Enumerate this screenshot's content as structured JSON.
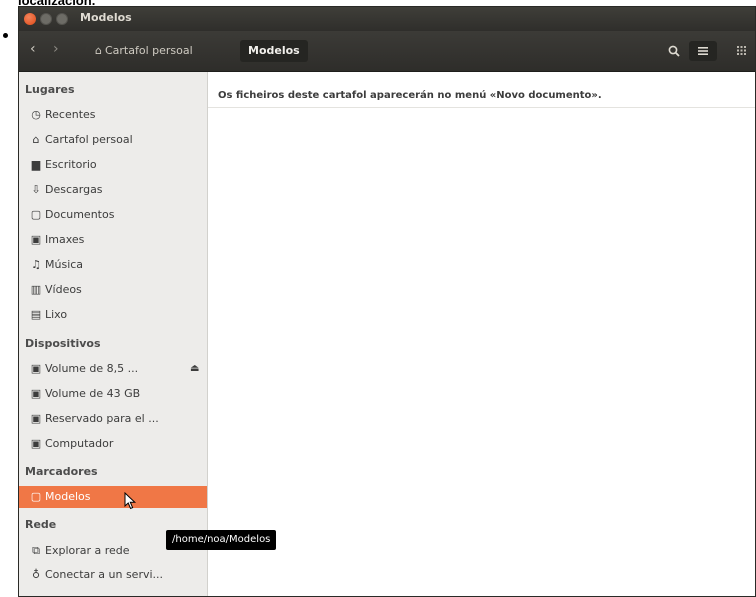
{
  "caption": "localización.",
  "window": {
    "title": "Modelos"
  },
  "toolbar": {
    "back_glyph": "‹",
    "forward_glyph": "›",
    "path": {
      "home_label": "Cartafol persoal",
      "current_label": "Modelos"
    },
    "icons": {
      "search": "search-icon",
      "list": "list-view-icon",
      "grid": "grid-view-icon"
    }
  },
  "sidebar": {
    "sections": [
      {
        "title": "Lugares",
        "items": [
          {
            "label": "Recentes",
            "icon": "clock-icon",
            "glyph": "◷"
          },
          {
            "label": "Cartafol persoal",
            "icon": "home-icon",
            "glyph": "⌂"
          },
          {
            "label": "Escritorio",
            "icon": "desktop-folder-icon",
            "glyph": "▆"
          },
          {
            "label": "Descargas",
            "icon": "download-icon",
            "glyph": "⇩"
          },
          {
            "label": "Documentos",
            "icon": "document-icon",
            "glyph": "▢"
          },
          {
            "label": "Imaxes",
            "icon": "camera-icon",
            "glyph": "▣"
          },
          {
            "label": "Música",
            "icon": "music-icon",
            "glyph": "♫"
          },
          {
            "label": "Vídeos",
            "icon": "film-icon",
            "glyph": "▥"
          },
          {
            "label": "Lixo",
            "icon": "trash-icon",
            "glyph": "▤"
          }
        ]
      },
      {
        "title": "Dispositivos",
        "items": [
          {
            "label": "Volume de 8,5 ...",
            "icon": "drive-icon",
            "glyph": "▣",
            "eject": "⏏"
          },
          {
            "label": "Volume de 43 GB",
            "icon": "drive-icon",
            "glyph": "▣"
          },
          {
            "label": "Reservado para el ...",
            "icon": "drive-icon",
            "glyph": "▣"
          },
          {
            "label": "Computador",
            "icon": "computer-icon",
            "glyph": "▣"
          }
        ]
      },
      {
        "title": "Marcadores",
        "items": [
          {
            "label": "Modelos",
            "icon": "document-icon",
            "glyph": "▢",
            "selected": true
          }
        ]
      },
      {
        "title": "Rede",
        "items": [
          {
            "label": "Explorar a rede",
            "icon": "network-icon",
            "glyph": "⧉"
          },
          {
            "label": "Conectar a un servi...",
            "icon": "connect-server-icon",
            "glyph": "♁"
          }
        ]
      }
    ]
  },
  "main": {
    "info_message": "Os ficheiros deste cartafol aparecerán no menú «Novo documento»."
  },
  "tooltip": {
    "text": "/home/noa/Modelos"
  },
  "colors": {
    "accent": "#f07746",
    "titlebar": "#3c3b37",
    "sidebar_bg": "#edecea"
  }
}
